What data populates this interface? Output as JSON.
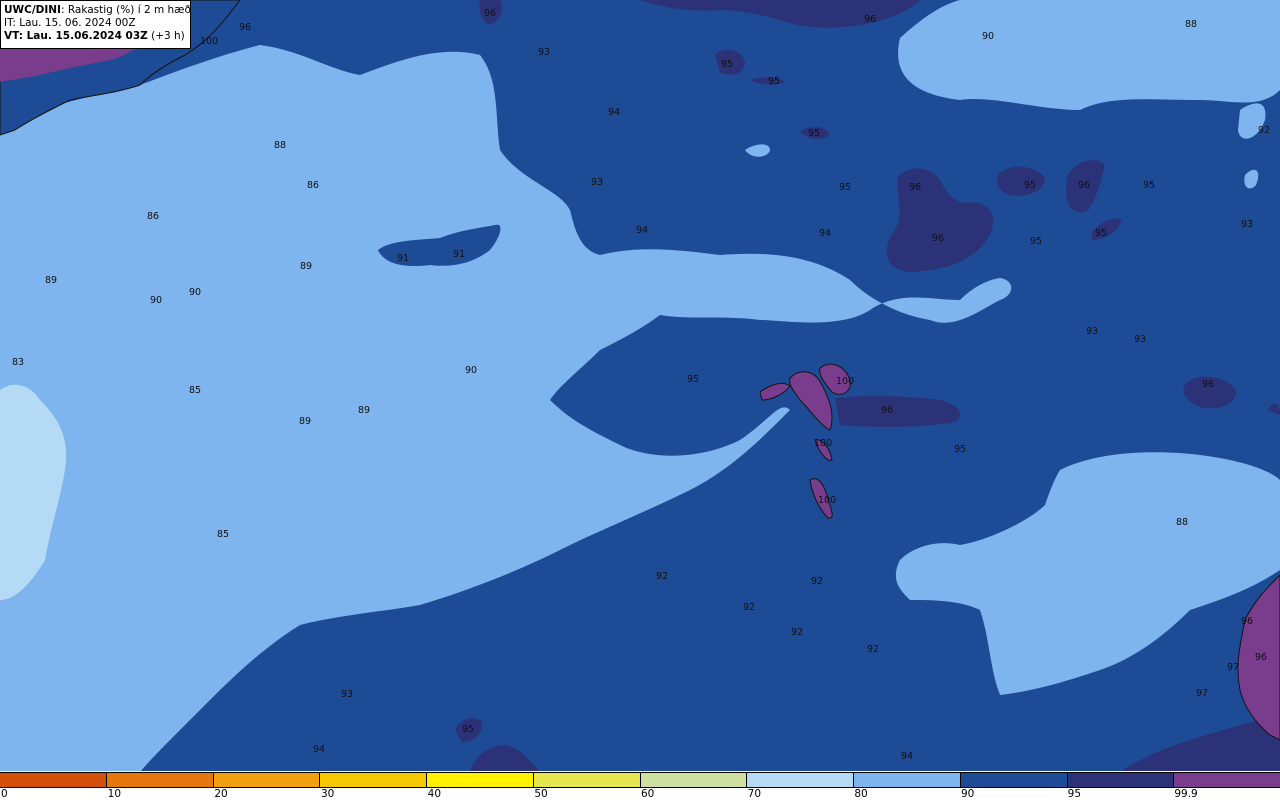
{
  "header": {
    "model": "UWC/DINI",
    "variable": ": Rakastig (%) í 2 m hæð",
    "it_label": "IT: Lau. 15. 06. 2024 00Z",
    "vt_label": "VT: Lau. 15.06.2024 03Z",
    "vt_offset": " (+3 h)"
  },
  "legend": {
    "colors": [
      "#d4500a",
      "#e4780f",
      "#f0a010",
      "#f5c800",
      "#fff200",
      "#e6e650",
      "#cde0a0",
      "#b4daf5",
      "#7fb5ee",
      "#1e4b96",
      "#2b3278",
      "#7a3c8c"
    ],
    "ticks": [
      "0",
      "10",
      "20",
      "30",
      "40",
      "50",
      "60",
      "70",
      "80",
      "90",
      "95",
      "99.9"
    ]
  },
  "map_labels": [
    {
      "text": "96"
    },
    {
      "text": "96"
    },
    {
      "text": "88"
    },
    {
      "text": "93"
    },
    {
      "text": "90"
    },
    {
      "text": "95"
    },
    {
      "text": "95"
    },
    {
      "text": "94"
    },
    {
      "text": "95"
    },
    {
      "text": "92"
    },
    {
      "text": "88"
    },
    {
      "text": "93"
    },
    {
      "text": "86"
    },
    {
      "text": "95"
    },
    {
      "text": "96"
    },
    {
      "text": "95"
    },
    {
      "text": "96"
    },
    {
      "text": "95"
    },
    {
      "text": "86"
    },
    {
      "text": "94"
    },
    {
      "text": "94"
    },
    {
      "text": "96"
    },
    {
      "text": "95"
    },
    {
      "text": "95"
    },
    {
      "text": "93"
    },
    {
      "text": "91"
    },
    {
      "text": "91"
    },
    {
      "text": "89"
    },
    {
      "text": "89"
    },
    {
      "text": "90"
    },
    {
      "text": "90"
    },
    {
      "text": "93"
    },
    {
      "text": "93"
    },
    {
      "text": "83"
    },
    {
      "text": "90"
    },
    {
      "text": "95"
    },
    {
      "text": "100"
    },
    {
      "text": "96"
    },
    {
      "text": "85"
    },
    {
      "text": "89"
    },
    {
      "text": "89"
    },
    {
      "text": "96"
    },
    {
      "text": "100"
    },
    {
      "text": "95"
    },
    {
      "text": "100"
    },
    {
      "text": "88"
    },
    {
      "text": "85"
    },
    {
      "text": "92"
    },
    {
      "text": "92"
    },
    {
      "text": "92"
    },
    {
      "text": "92"
    },
    {
      "text": "92"
    },
    {
      "text": "93"
    },
    {
      "text": "95"
    },
    {
      "text": "94"
    },
    {
      "text": "94"
    },
    {
      "text": "96"
    },
    {
      "text": "97"
    },
    {
      "text": "96"
    },
    {
      "text": "100"
    },
    {
      "text": "96"
    },
    {
      "text": "97"
    }
  ]
}
